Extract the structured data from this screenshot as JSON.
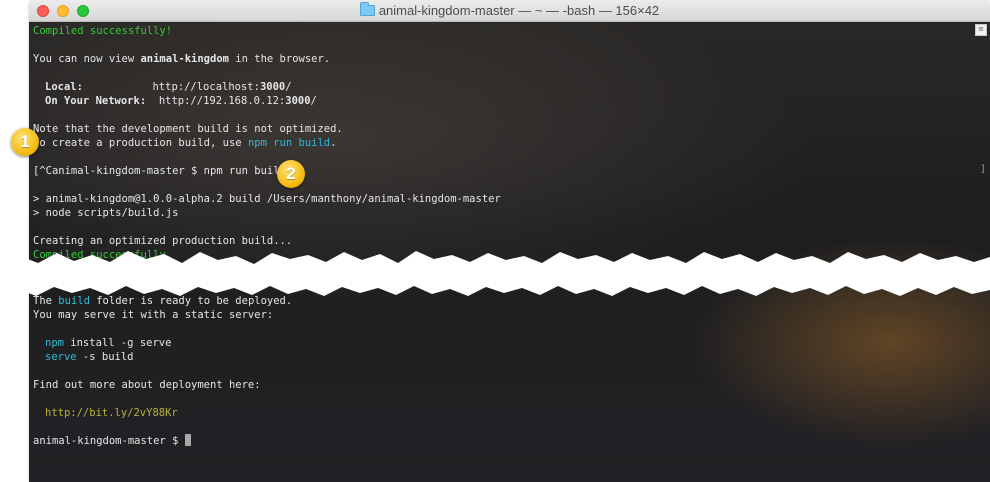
{
  "window": {
    "title": "animal-kingdom-master — ~ — -bash — 156×42"
  },
  "terminal": {
    "compiled": "Compiled successfully!",
    "view_pre": "You can now view ",
    "view_app": "animal-kingdom",
    "view_post": " in the browser.",
    "local_label": "Local:",
    "local_url_pre": "http://localhost:",
    "local_port": "3000",
    "local_url_post": "/",
    "network_label": "On Your Network:",
    "network_url_pre": "http://192.168.0.12:",
    "network_port": "3000",
    "network_url_post": "/",
    "note": "Note that the development build is not optimized.",
    "prod_pre": "To create a production build, use ",
    "prod_cmd": "npm run build",
    "prod_post": ".",
    "prompt_command": "[^Canimal-kingdom-master $ npm run build",
    "right_bracket": "]",
    "build_info": "> animal-kingdom@1.0.0-alpha.2 build /Users/manthony/animal-kingdom-master",
    "build_script": "> node scripts/build.js",
    "creating": "Creating an optimized production build...",
    "compiled_partial": "Compiled successfully.",
    "ready_pre": "The ",
    "ready_word": "build",
    "ready_post": " folder is ready to be deployed.",
    "serve_static": "You may serve it with a static server:",
    "npm_word": "npm",
    "npm_rest": " install -g serve",
    "serve_word": "serve",
    "serve_rest": " -s build",
    "find_out": "Find out more about deployment here:",
    "deploy_url": "http://bit.ly/2vY88Kr",
    "final_prompt": "animal-kingdom-master $ "
  },
  "callouts": {
    "one": "1",
    "two": "2"
  }
}
